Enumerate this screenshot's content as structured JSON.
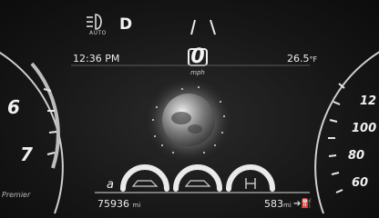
{
  "top": {
    "gear": "D",
    "headlight_icon": "auto-headlight-icon",
    "auto_label": "AUTO"
  },
  "info": {
    "time": "12:36 PM",
    "temperature": "26.5",
    "temperature_unit": "°F",
    "speed": "0",
    "speed_unit": "mph"
  },
  "left_gauge": {
    "labels": [
      "6",
      "7"
    ]
  },
  "right_gauge": {
    "labels": [
      "12",
      "100",
      "80",
      "60"
    ]
  },
  "bottom": {
    "odometer": "75936",
    "odometer_unit": "mi",
    "range": "583",
    "range_unit": "mi",
    "fuel_icon": "fuel-pump-icon",
    "drive_mode_label": "a",
    "brand_script": "Premier"
  },
  "colors": {
    "background": "#0e0e0e",
    "text": "#e8e8e8"
  }
}
